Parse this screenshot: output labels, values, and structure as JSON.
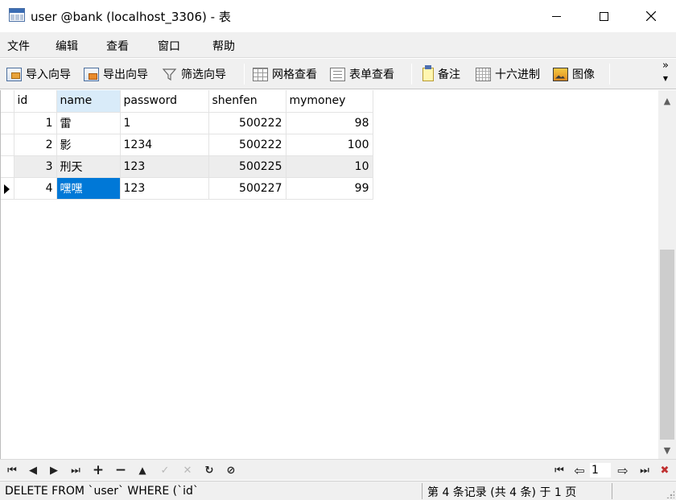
{
  "window": {
    "title": "user @bank (localhost_3306) - 表"
  },
  "menu": [
    "文件",
    "编辑",
    "查看",
    "窗口",
    "帮助"
  ],
  "toolbar": {
    "import_wizard": "导入向导",
    "export_wizard": "导出向导",
    "filter_wizard": "筛选向导",
    "grid_view": "网格查看",
    "form_view": "表单查看",
    "note": "备注",
    "hex": "十六进制",
    "image": "图像",
    "more": "»"
  },
  "table": {
    "columns": [
      "id",
      "name",
      "password",
      "shenfen",
      "mymoney"
    ],
    "rows": [
      {
        "id": "1",
        "name": "雷",
        "password": "1",
        "shenfen": "500222",
        "mymoney": "98"
      },
      {
        "id": "2",
        "name": "影",
        "password": "1234",
        "shenfen": "500222",
        "mymoney": "100"
      },
      {
        "id": "3",
        "name": "刑天",
        "password": "123",
        "shenfen": "500225",
        "mymoney": "10"
      },
      {
        "id": "4",
        "name": "嘿嘿",
        "password": "123",
        "shenfen": "500227",
        "mymoney": "99"
      }
    ]
  },
  "nav": {
    "page": "1"
  },
  "status": {
    "sql": "DELETE FROM `user` WHERE (`id`",
    "records": "第 4 条记录 (共 4 条) 于 1 页"
  }
}
